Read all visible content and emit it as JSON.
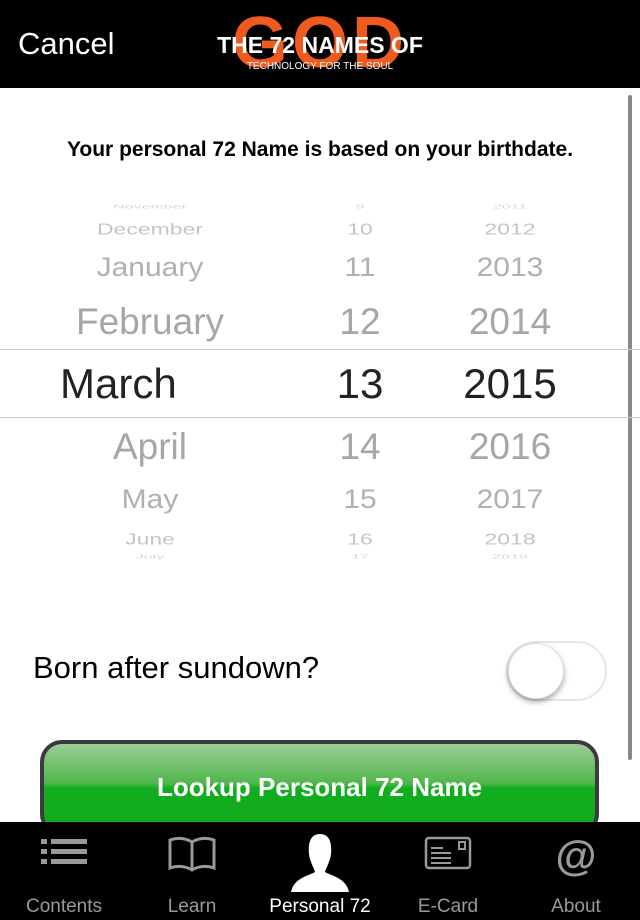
{
  "header": {
    "cancel_label": "Cancel",
    "logo": {
      "word": "GOD",
      "title": "THE 72 NAMES OF",
      "tagline": "TECHNOLOGY FOR THE SOUL"
    }
  },
  "intro": "Your personal 72 Name is based on your birthdate.",
  "picker": {
    "months": [
      "November",
      "December",
      "January",
      "February",
      "March",
      "April",
      "May",
      "June",
      "July"
    ],
    "days": [
      "9",
      "10",
      "11",
      "12",
      "13",
      "14",
      "15",
      "16",
      "17"
    ],
    "years": [
      "2011",
      "2012",
      "2013",
      "2014",
      "2015",
      "2016",
      "2017",
      "2018",
      "2019"
    ],
    "selected": {
      "month": "March",
      "day": "13",
      "year": "2015"
    }
  },
  "sundown": {
    "label": "Born after sundown?",
    "on": false
  },
  "lookup_label": "Lookup Personal 72 Name",
  "tabs": [
    {
      "label": "Contents",
      "icon": "list-icon"
    },
    {
      "label": "Learn",
      "icon": "book-icon"
    },
    {
      "label": "Personal 72",
      "icon": "person-icon",
      "active": true
    },
    {
      "label": "E-Card",
      "icon": "card-icon"
    },
    {
      "label": "About",
      "icon": "at-icon"
    }
  ],
  "colors": {
    "accent_green": "#12ae1f",
    "logo_orange": "#f05a1e"
  }
}
